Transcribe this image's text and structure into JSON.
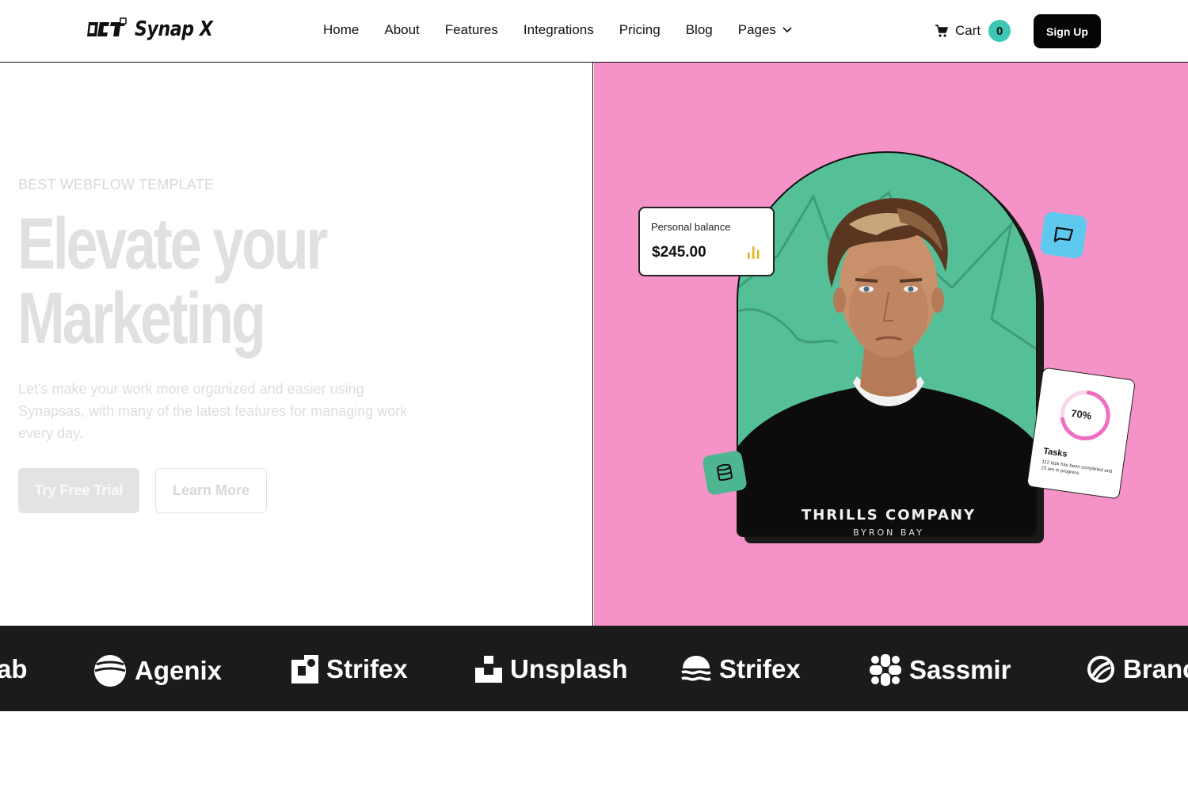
{
  "nav": {
    "logo_text": "Synap X",
    "links": [
      "Home",
      "About",
      "Features",
      "Integrations",
      "Pricing",
      "Blog",
      "Pages"
    ],
    "cart_label": "Cart",
    "cart_count": "0",
    "signup_label": "Sign Up"
  },
  "hero": {
    "eyebrow": "BEST WEBFLOW TEMPLATE",
    "headline_line1": "Elevate your",
    "headline_line2": "Marketing",
    "subtext": "Let's make your work more organized and easier using Synapsas, with many of the latest features for managing work every day.",
    "primary_cta": "Try Free Trial",
    "secondary_cta": "Learn More"
  },
  "visual": {
    "balance_label": "Personal balance",
    "balance_amount": "$245.00",
    "tasks_percent": "70%",
    "tasks_progress": 0.7,
    "tasks_title": "Tasks",
    "tasks_desc": "112 task has been completed and 23 are in progress.",
    "shirt_line1": "THRILLS COMPANY",
    "shirt_line2": "BYRON BAY",
    "colors": {
      "pink_bg": "#f592c8",
      "arch_green": "#55bf97",
      "badge_blue": "#5ec8ee",
      "progress_pink": "#f06ec1"
    }
  },
  "logos": [
    "ab",
    "Agenix",
    "Strifex",
    "Unsplash",
    "Strifex",
    "Sassmir",
    "Branc"
  ]
}
